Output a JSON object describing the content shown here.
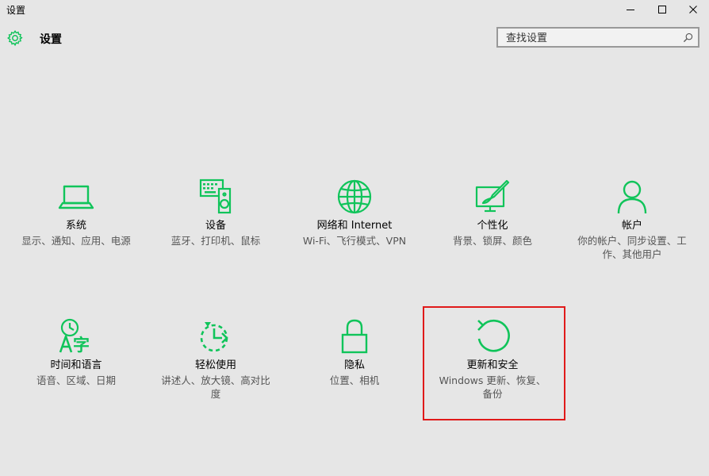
{
  "window": {
    "title": "设置"
  },
  "header": {
    "title": "设置"
  },
  "search": {
    "placeholder": "查找设置"
  },
  "colors": {
    "accent": "#10c45a",
    "highlight": "#e01a1a"
  },
  "tiles": [
    {
      "name": "系统",
      "desc": "显示、通知、应用、电源",
      "icon": "laptop-icon"
    },
    {
      "name": "设备",
      "desc": "蓝牙、打印机、鼠标",
      "icon": "devices-icon"
    },
    {
      "name": "网络和 Internet",
      "desc": "Wi-Fi、飞行模式、VPN",
      "icon": "globe-icon"
    },
    {
      "name": "个性化",
      "desc": "背景、锁屏、颜色",
      "icon": "personalization-icon"
    },
    {
      "name": "帐户",
      "desc": "你的帐户、同步设置、工作、其他用户",
      "icon": "person-icon"
    },
    {
      "name": "时间和语言",
      "desc": "语音、区域、日期",
      "icon": "time-language-icon"
    },
    {
      "name": "轻松使用",
      "desc": "讲述人、放大镜、高对比度",
      "icon": "ease-of-access-icon"
    },
    {
      "name": "隐私",
      "desc": "位置、相机",
      "icon": "lock-icon"
    },
    {
      "name": "更新和安全",
      "desc": "Windows 更新、恢复、备份",
      "icon": "refresh-icon"
    }
  ]
}
